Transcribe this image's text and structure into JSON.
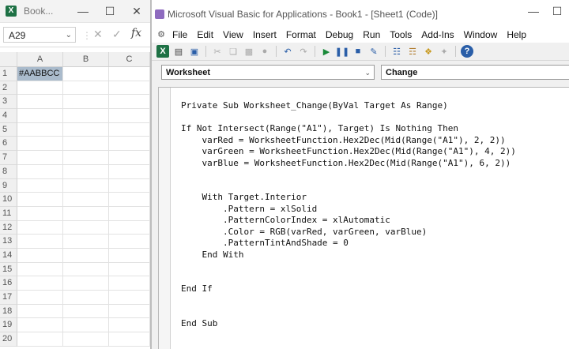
{
  "excel": {
    "title": "Book...",
    "name_box": "A29",
    "fx_label": "fx",
    "columns": [
      "A",
      "B",
      "C"
    ],
    "rows": [
      "1",
      "2",
      "3",
      "4",
      "5",
      "6",
      "7",
      "8",
      "9",
      "10",
      "11",
      "12",
      "13",
      "14",
      "15",
      "16",
      "17",
      "18",
      "19",
      "20"
    ],
    "a1_value": "#AABBCC",
    "a1_fill": "#AABBCC"
  },
  "vba": {
    "title": "Microsoft Visual Basic for Applications - Book1 - [Sheet1 (Code)]",
    "menu": [
      "File",
      "Edit",
      "View",
      "Insert",
      "Format",
      "Debug",
      "Run",
      "Tools",
      "Add-Ins",
      "Window",
      "Help"
    ],
    "object_combo": "Worksheet",
    "procedure_combo": "Change",
    "code_lines": [
      "Private Sub Worksheet_Change(ByVal Target As Range)",
      "",
      "If Not Intersect(Range(\"A1\"), Target) Is Nothing Then",
      "    varRed = WorksheetFunction.Hex2Dec(Mid(Range(\"A1\"), 2, 2))",
      "    varGreen = WorksheetFunction.Hex2Dec(Mid(Range(\"A1\"), 4, 2))",
      "    varBlue = WorksheetFunction.Hex2Dec(Mid(Range(\"A1\"), 6, 2))",
      "",
      "",
      "    With Target.Interior",
      "        .Pattern = xlSolid",
      "        .PatternColorIndex = xlAutomatic",
      "        .Color = RGB(varRed, varGreen, varBlue)",
      "        .PatternTintAndShade = 0",
      "    End With",
      "",
      "",
      "End If",
      "",
      "",
      "End Sub"
    ]
  },
  "icons": {
    "excel_app": "excel-logo-icon",
    "vba_app": "vba-logo-icon"
  }
}
